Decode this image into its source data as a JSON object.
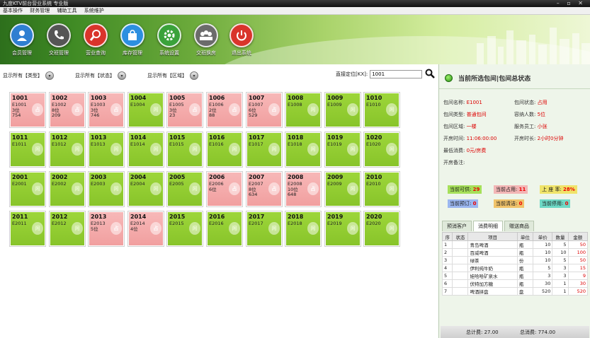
{
  "window": {
    "title": "九度KTV前台营业系统 专业版",
    "controls": "– ▫ ✕"
  },
  "menu": [
    "基本操作",
    "财务管理",
    "辅助工具",
    "系统维护"
  ],
  "toolbar": [
    {
      "label": "会员管理",
      "icon": "user-icon",
      "color": "#2f7fd1"
    },
    {
      "label": "交班管理",
      "icon": "phone-icon",
      "color": "#555555"
    },
    {
      "label": "营业查询",
      "icon": "search-icon",
      "color": "#d9342b"
    },
    {
      "label": "库存管理",
      "icon": "bag-icon",
      "color": "#2c8fe0"
    },
    {
      "label": "系统设置",
      "icon": "gear-icon",
      "color": "#3aa23a"
    },
    {
      "label": "交班换房",
      "icon": "group-icon",
      "color": "#6b6b6b"
    },
    {
      "label": "退出系统",
      "icon": "power-icon",
      "color": "#d9342b"
    }
  ],
  "filters": [
    {
      "label": "显示所有【类型】"
    },
    {
      "label": "显示所有【状态】"
    },
    {
      "label": "显示所有【区域】"
    }
  ],
  "search": {
    "label": "直接定位[KX]:",
    "value": "1001"
  },
  "rooms": [
    {
      "num": "1001",
      "status": "busy",
      "info": [
        "E1001",
        "3位",
        "754"
      ],
      "badge": "占"
    },
    {
      "num": "1002",
      "status": "busy",
      "info": [
        "E1002",
        "8位",
        "209"
      ],
      "badge": "占"
    },
    {
      "num": "1003",
      "status": "busy",
      "info": [
        "E1003",
        "3位",
        "746"
      ],
      "badge": "占"
    },
    {
      "num": "1004",
      "status": "free",
      "info": [
        "E1004"
      ],
      "badge": "闲"
    },
    {
      "num": "1005",
      "status": "busy",
      "info": [
        "E1005",
        "3位",
        "23"
      ],
      "badge": "占"
    },
    {
      "num": "1006",
      "status": "busy",
      "info": [
        "E1006",
        "2位",
        "88"
      ],
      "badge": "占"
    },
    {
      "num": "1007",
      "status": "busy",
      "info": [
        "E1007",
        "6位",
        "529"
      ],
      "badge": "占"
    },
    {
      "num": "1008",
      "status": "free",
      "info": [
        "E1008"
      ],
      "badge": "闲"
    },
    {
      "num": "1009",
      "status": "free",
      "info": [
        "E1009"
      ],
      "badge": "闲"
    },
    {
      "num": "1010",
      "status": "free",
      "info": [
        "E1010"
      ],
      "badge": "闲"
    },
    {
      "num": "1011",
      "status": "free",
      "info": [
        "E1011"
      ],
      "badge": "闲"
    },
    {
      "num": "1012",
      "status": "free",
      "info": [
        "E1012"
      ],
      "badge": "闲"
    },
    {
      "num": "1013",
      "status": "free",
      "info": [
        "E1013"
      ],
      "badge": "闲"
    },
    {
      "num": "1014",
      "status": "free",
      "info": [
        "E1014"
      ],
      "badge": "闲"
    },
    {
      "num": "1015",
      "status": "free",
      "info": [
        "E1015"
      ],
      "badge": "闲"
    },
    {
      "num": "1016",
      "status": "free",
      "info": [
        "E1016"
      ],
      "badge": "闲"
    },
    {
      "num": "1017",
      "status": "free",
      "info": [
        "E1017"
      ],
      "badge": "闲"
    },
    {
      "num": "1018",
      "status": "free",
      "info": [
        "E1018"
      ],
      "badge": "闲"
    },
    {
      "num": "1019",
      "status": "free",
      "info": [
        "E1019"
      ],
      "badge": "闲"
    },
    {
      "num": "1020",
      "status": "free",
      "info": [
        "E1020"
      ],
      "badge": "闲"
    },
    {
      "num": "2001",
      "status": "free",
      "info": [
        "E2001"
      ],
      "badge": "闲"
    },
    {
      "num": "2002",
      "status": "free",
      "info": [
        "E2002"
      ],
      "badge": "闲"
    },
    {
      "num": "2003",
      "status": "free",
      "info": [
        "E2003"
      ],
      "badge": "闲"
    },
    {
      "num": "2004",
      "status": "free",
      "info": [
        "E2004"
      ],
      "badge": "闲"
    },
    {
      "num": "2005",
      "status": "free",
      "info": [
        "E2005"
      ],
      "badge": "闲"
    },
    {
      "num": "2006",
      "status": "busy",
      "info": [
        "E2006",
        "6位"
      ],
      "badge": "占"
    },
    {
      "num": "2007",
      "status": "busy",
      "info": [
        "E2007",
        "8位",
        "634"
      ],
      "badge": "占"
    },
    {
      "num": "2008",
      "status": "busy",
      "info": [
        "E2008",
        "10位",
        "648"
      ],
      "badge": "占"
    },
    {
      "num": "2009",
      "status": "free",
      "info": [
        "E2009"
      ],
      "badge": "闲"
    },
    {
      "num": "2010",
      "status": "free",
      "info": [
        "E2010"
      ],
      "badge": "闲"
    },
    {
      "num": "2011",
      "status": "free",
      "info": [
        "E2011"
      ],
      "badge": "闲"
    },
    {
      "num": "2012",
      "status": "free",
      "info": [
        "E2012"
      ],
      "badge": "闲"
    },
    {
      "num": "2013",
      "status": "busy",
      "info": [
        "E2013",
        "5位"
      ],
      "badge": "占"
    },
    {
      "num": "2014",
      "status": "busy",
      "info": [
        "E2014",
        "4位"
      ],
      "badge": "占"
    },
    {
      "num": "2015",
      "status": "free",
      "info": [
        "E2015"
      ],
      "badge": "闲"
    },
    {
      "num": "2016",
      "status": "free",
      "info": [
        "E2016"
      ],
      "badge": "闲"
    },
    {
      "num": "2017",
      "status": "free",
      "info": [
        "E2017"
      ],
      "badge": "闲"
    },
    {
      "num": "2018",
      "status": "free",
      "info": [
        "E2018"
      ],
      "badge": "闲"
    },
    {
      "num": "2019",
      "status": "free",
      "info": [
        "E2019"
      ],
      "badge": "闲"
    },
    {
      "num": "2020",
      "status": "free",
      "info": [
        "E2020"
      ],
      "badge": "闲"
    }
  ],
  "panel": {
    "title": "当前所选包间|包间总状态",
    "fields": [
      {
        "label": "包间名称:",
        "value": "E1001"
      },
      {
        "label": "包间状态:",
        "value": "占用"
      },
      {
        "label": "包间类型:",
        "value": "普通包间"
      },
      {
        "label": "容纳人数:",
        "value": "5位"
      },
      {
        "label": "包间区域:",
        "value": "一楼"
      },
      {
        "label": "服务员工:",
        "value": "小张"
      },
      {
        "label": "开房时间:",
        "value": "11:06:00:00"
      },
      {
        "label": "开房时长:",
        "value": "2小时0分钟"
      },
      {
        "label": "最低消费:",
        "value": "0元/房费"
      },
      {
        "label": "开房备注:",
        "value": ""
      }
    ],
    "stats": [
      {
        "label": "当前可供:",
        "value": "29"
      },
      {
        "label": "当前占用:",
        "value": "11"
      },
      {
        "label": "上 座 率:",
        "value": "28%"
      },
      {
        "label": "当前预订:",
        "value": "0"
      },
      {
        "label": "当前清洁:",
        "value": "0"
      },
      {
        "label": "当前停用:",
        "value": "0"
      }
    ],
    "tabs": [
      "预消客户",
      "消费明细",
      "赠送商品"
    ],
    "table": {
      "headers": [
        "序",
        "状态",
        "项目",
        "单位",
        "单价",
        "数量",
        "金额"
      ],
      "rows": [
        [
          "1",
          "",
          "青岛啤酒",
          "瓶",
          "10",
          "5",
          "50"
        ],
        [
          "2",
          "",
          "百威啤酒",
          "瓶",
          "10",
          "10",
          "100"
        ],
        [
          "3",
          "",
          "绿茶",
          "份",
          "10",
          "5",
          "50"
        ],
        [
          "4",
          "",
          "伊利纯牛奶",
          "瓶",
          "5",
          "3",
          "15"
        ],
        [
          "5",
          "",
          "娃哈哈矿泉水",
          "瓶",
          "3",
          "3",
          "9"
        ],
        [
          "6",
          "",
          "伏特加方糖",
          "瓶",
          "30",
          "1",
          "30"
        ],
        [
          "7",
          "",
          "啤酒拼盘",
          "盘",
          "520",
          "1",
          "520"
        ]
      ]
    },
    "footer": {
      "left": "总计费: 27.00",
      "right": "总消费: 774.00"
    }
  }
}
